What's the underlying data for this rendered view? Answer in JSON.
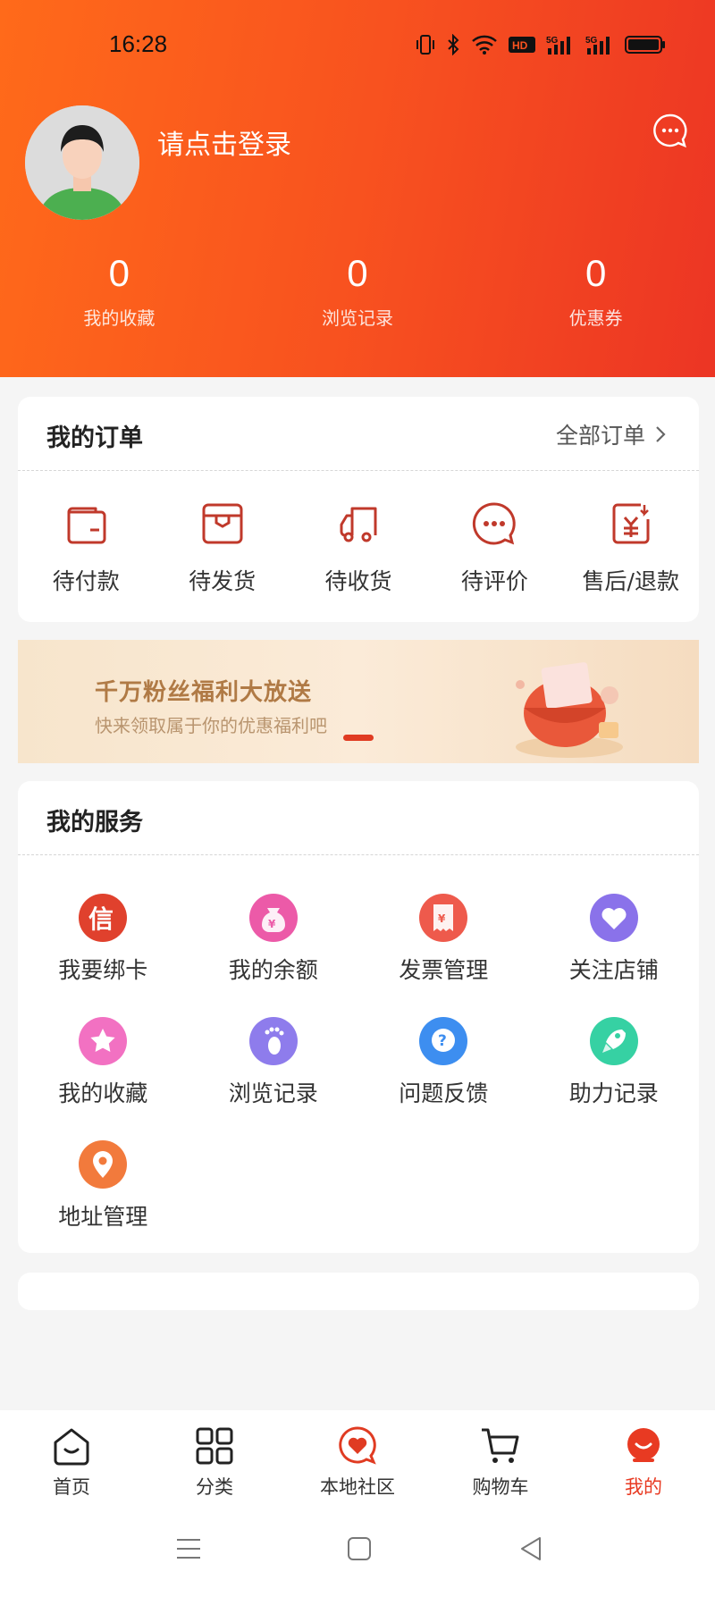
{
  "status_bar": {
    "time": "16:28"
  },
  "header": {
    "login_prompt": "请点击登录",
    "stats": [
      {
        "value": "0",
        "label": "我的收藏"
      },
      {
        "value": "0",
        "label": "浏览记录"
      },
      {
        "value": "0",
        "label": "优惠券"
      }
    ]
  },
  "orders": {
    "title": "我的订单",
    "all_label": "全部订单",
    "items": [
      {
        "label": "待付款",
        "icon": "wallet-icon"
      },
      {
        "label": "待发货",
        "icon": "box-icon"
      },
      {
        "label": "待收货",
        "icon": "truck-icon"
      },
      {
        "label": "待评价",
        "icon": "comment-icon"
      },
      {
        "label": "售后/退款",
        "icon": "refund-icon"
      }
    ]
  },
  "banner": {
    "title": "千万粉丝福利大放送",
    "subtitle": "快来领取属于你的优惠福利吧"
  },
  "services": {
    "title": "我的服务",
    "items": [
      {
        "label": "我要绑卡",
        "icon": "bind-card-icon",
        "color": "#e0412d"
      },
      {
        "label": "我的余额",
        "icon": "money-bag-icon",
        "color": "#ec5aa8"
      },
      {
        "label": "发票管理",
        "icon": "invoice-icon",
        "color": "#ee5a4c"
      },
      {
        "label": "关注店铺",
        "icon": "heart-icon",
        "color": "#8a72ea"
      },
      {
        "label": "我的收藏",
        "icon": "star-icon",
        "color": "#f271c2"
      },
      {
        "label": "浏览记录",
        "icon": "footprint-icon",
        "color": "#8e7cec"
      },
      {
        "label": "问题反馈",
        "icon": "question-icon",
        "color": "#3d8ef0"
      },
      {
        "label": "助力记录",
        "icon": "rocket-icon",
        "color": "#36d1a3"
      },
      {
        "label": "地址管理",
        "icon": "location-icon",
        "color": "#f27a3c"
      }
    ]
  },
  "nav": {
    "items": [
      {
        "label": "首页",
        "icon": "home-icon",
        "active": false
      },
      {
        "label": "分类",
        "icon": "category-icon",
        "active": false
      },
      {
        "label": "本地社区",
        "icon": "community-icon",
        "active": false
      },
      {
        "label": "购物车",
        "icon": "cart-icon",
        "active": false
      },
      {
        "label": "我的",
        "icon": "profile-icon",
        "active": true
      }
    ]
  },
  "colors": {
    "accent": "#e83a22",
    "header_start": "#ff6a1a",
    "header_end": "#ec3524"
  }
}
